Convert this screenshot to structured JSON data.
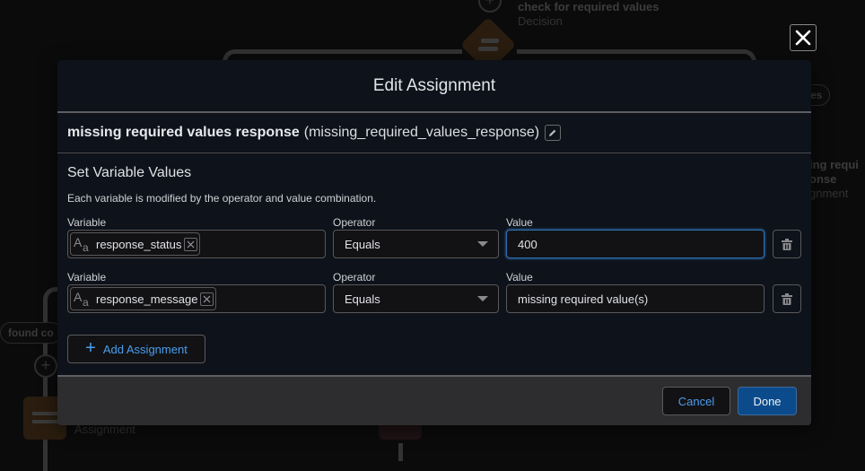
{
  "background": {
    "decision_node": {
      "label": "check for required values",
      "type": "Decision"
    },
    "right_node": {
      "label_line1": "ing requi",
      "label_line2": "onse",
      "type": "gnment"
    },
    "right_pill": "es",
    "left_pill": "found co",
    "left_node": {
      "type": "Assignment"
    }
  },
  "close_button": {
    "icon": "close-icon"
  },
  "modal": {
    "title": "Edit Assignment",
    "element": {
      "label": "missing required values response",
      "api_name": "(missing_required_values_response)",
      "edit_icon": "pencil-icon"
    },
    "section": {
      "title": "Set Variable Values",
      "help": "Each variable is modified by the operator and value combination."
    },
    "columns": {
      "variable": "Variable",
      "operator": "Operator",
      "value": "Value"
    },
    "assignments": [
      {
        "variable": "response_status",
        "variable_icon": "text-type-icon",
        "operator": "Equals",
        "value": "400",
        "focused": true
      },
      {
        "variable": "response_message",
        "variable_icon": "text-type-icon",
        "operator": "Equals",
        "value": "missing required value(s)",
        "focused": false
      }
    ],
    "add_assignment_label": "Add Assignment",
    "footer": {
      "cancel_label": "Cancel",
      "done_label": "Done"
    }
  },
  "colors": {
    "accent_blue": "#4a9ef0",
    "done_button": "#0b4b8c",
    "modal_bg": "#0e121a",
    "footer_bg": "#2d2d2f"
  }
}
